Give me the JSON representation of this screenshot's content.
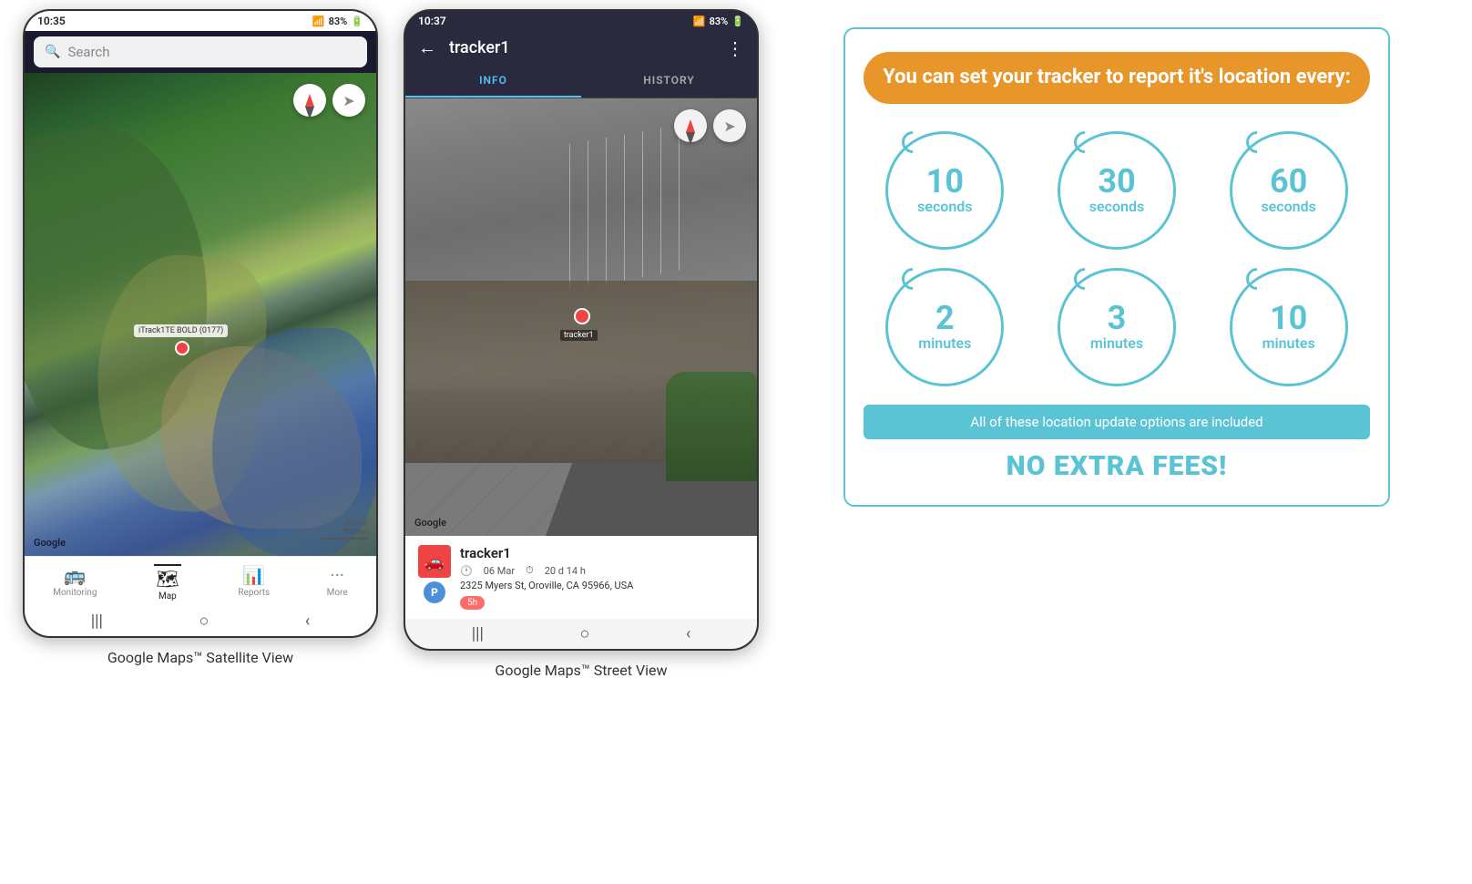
{
  "phone1": {
    "status_time": "10:35",
    "status_signal": "📶",
    "status_battery": "83%",
    "search_placeholder": "Search",
    "map_label": "iTrack1TE BOLD (0177)",
    "google_watermark": "Google",
    "scale_text": "200 mi\n500 km",
    "nav_items": [
      {
        "label": "Monitoring",
        "icon": "🚌",
        "active": false
      },
      {
        "label": "Map",
        "icon": "🗺",
        "active": true
      },
      {
        "label": "Reports",
        "icon": "📊",
        "active": false
      },
      {
        "label": "More",
        "icon": "···",
        "active": false
      }
    ],
    "caption": "Google Maps™ Satellite View"
  },
  "phone2": {
    "status_time": "10:37",
    "status_battery": "83%",
    "tracker_name": "tracker1",
    "back_icon": "←",
    "more_icon": "⋮",
    "tabs": [
      {
        "label": "INFO",
        "active": true
      },
      {
        "label": "HISTORY",
        "active": false
      }
    ],
    "tracker_device_name": "tracker1",
    "tracker_date": "06 Mar",
    "tracker_duration": "20 d 14 h",
    "tracker_address": "2325 Myers St, Oroville, CA 95966, USA",
    "tracker_time_badge": "5h",
    "google_watermark": "Google",
    "aerial_label": "tracker1",
    "caption": "Google Maps™ Street View"
  },
  "infographic": {
    "title": "You can set your tracker to report it's location every:",
    "circles": [
      {
        "number": "10",
        "unit": "seconds"
      },
      {
        "number": "30",
        "unit": "seconds"
      },
      {
        "number": "60",
        "unit": "seconds"
      },
      {
        "number": "2",
        "unit": "minutes"
      },
      {
        "number": "3",
        "unit": "minutes"
      },
      {
        "number": "10",
        "unit": "minutes"
      }
    ],
    "included_text": "All of these location update options are included",
    "no_fees_text": "NO EXTRA FEES!"
  }
}
